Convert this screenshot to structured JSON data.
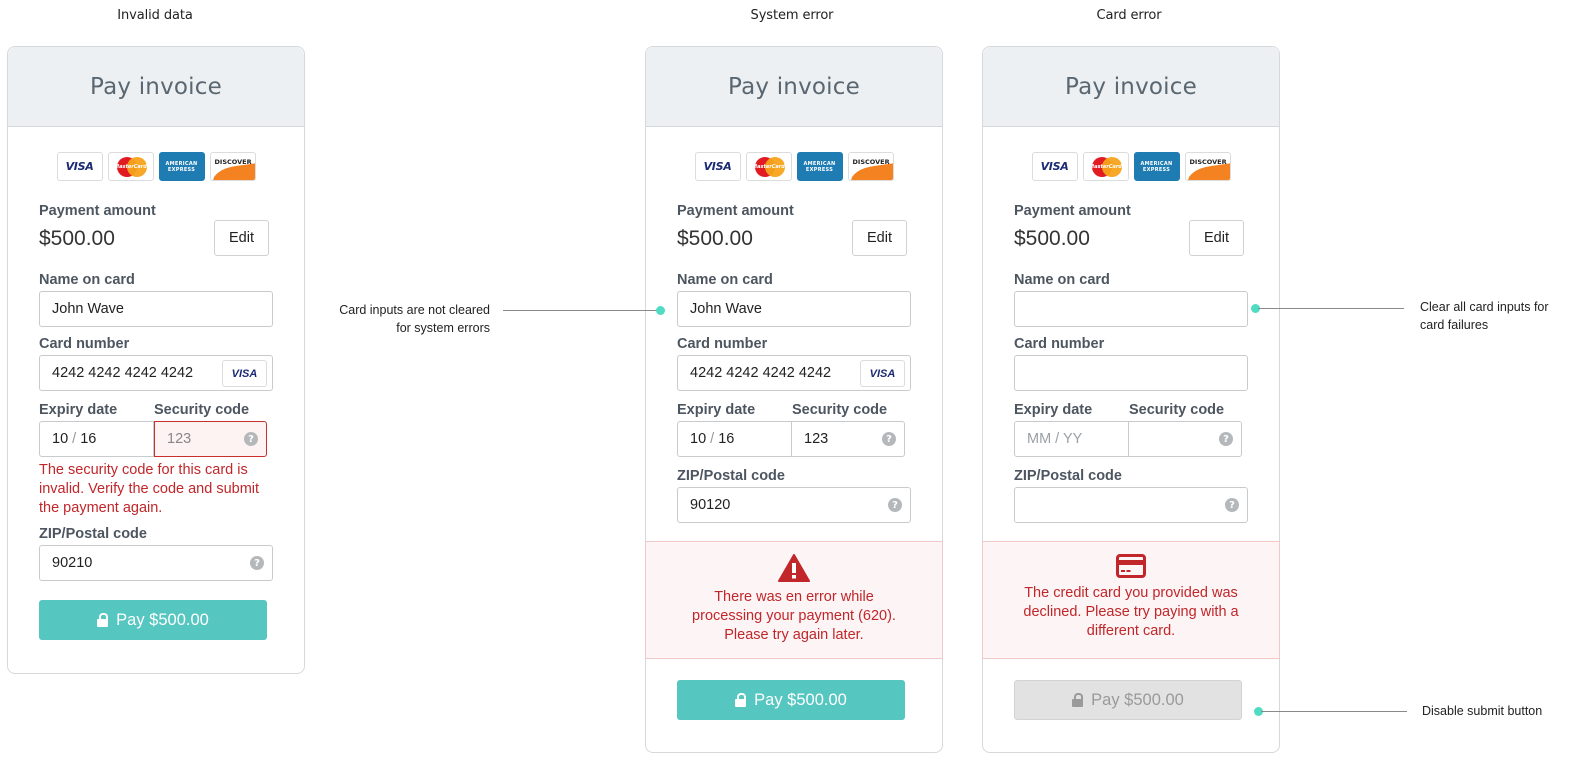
{
  "columns": [
    {
      "title": "Invalid data",
      "header": "Pay invoice",
      "card_logos": [
        "VISA",
        "MasterCard",
        "AMERICAN EXPRESS",
        "DISCOVER"
      ],
      "payment_amount_label": "Payment amount",
      "payment_amount": "$500.00",
      "edit_label": "Edit",
      "name_label": "Name on card",
      "name_value": "John Wave",
      "card_number_label": "Card number",
      "card_number_value": "4242 4242 4242 4242",
      "card_brand": "VISA",
      "expiry_label": "Expiry date",
      "expiry_month": "10",
      "expiry_year": "16",
      "security_label": "Security code",
      "security_value": "123",
      "security_error": "The security code for this card is invalid. Verify the code and submit the payment again.",
      "zip_label": "ZIP/Postal code",
      "zip_value": "90210",
      "pay_label": "Pay $500.00"
    },
    {
      "title": "System error",
      "header": "Pay invoice",
      "card_logos": [
        "VISA",
        "MasterCard",
        "AMERICAN EXPRESS",
        "DISCOVER"
      ],
      "payment_amount_label": "Payment amount",
      "payment_amount": "$500.00",
      "edit_label": "Edit",
      "name_label": "Name on card",
      "name_value": "John Wave",
      "card_number_label": "Card number",
      "card_number_value": "4242 4242 4242 4242",
      "card_brand": "VISA",
      "expiry_label": "Expiry date",
      "expiry_month": "10",
      "expiry_year": "16",
      "security_label": "Security code",
      "security_value": "123",
      "zip_label": "ZIP/Postal code",
      "zip_value": "90120",
      "alert_icon": "warning-triangle-icon",
      "alert_text": "There was en error while processing your payment (620). Please try again later.",
      "pay_label": "Pay $500.00"
    },
    {
      "title": "Card error",
      "header": "Pay invoice",
      "card_logos": [
        "VISA",
        "MasterCard",
        "AMERICAN EXPRESS",
        "DISCOVER"
      ],
      "payment_amount_label": "Payment amount",
      "payment_amount": "$500.00",
      "edit_label": "Edit",
      "name_label": "Name on card",
      "name_value": "",
      "card_number_label": "Card number",
      "card_number_value": "",
      "expiry_label": "Expiry date",
      "expiry_placeholder": "MM / YY",
      "security_label": "Security code",
      "security_value": "",
      "zip_label": "ZIP/Postal code",
      "zip_value": "",
      "alert_icon": "credit-card-icon",
      "alert_text": "The credit card you provided was declined. Please try paying with a different card.",
      "pay_label": "Pay $500.00",
      "pay_disabled": true
    }
  ],
  "annotations": {
    "system_inputs": "Card inputs are not cleared for system errors",
    "card_clear": "Clear all card inputs for card failures",
    "disable_submit": "Disable submit button"
  },
  "colors": {
    "accent": "#55c6c0",
    "error": "#c0262a",
    "annotation_dot": "#4fdcc2",
    "header_bg": "#edf0f3"
  }
}
